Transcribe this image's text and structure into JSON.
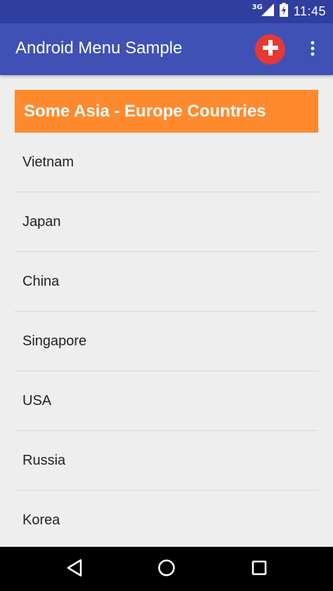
{
  "status_bar": {
    "network_type": "3G",
    "time": "11:45",
    "icons": [
      "signal-icon",
      "battery-charging-icon"
    ]
  },
  "app_bar": {
    "title": "Android Menu Sample",
    "actions": [
      "add-icon",
      "overflow-menu-icon"
    ]
  },
  "content": {
    "header": "Some Asia - Europe Countries",
    "countries": [
      "Vietnam",
      "Japan",
      "China",
      "Singapore",
      "USA",
      "Russia",
      "Korea"
    ]
  },
  "nav_bar": {
    "buttons": [
      "back-icon",
      "home-icon",
      "recents-icon"
    ]
  },
  "colors": {
    "status_bar": "#303f9f",
    "app_bar": "#3f51b5",
    "add_button": "#e53935",
    "header_box": "#ff8a2e",
    "background": "#eeeeee"
  }
}
